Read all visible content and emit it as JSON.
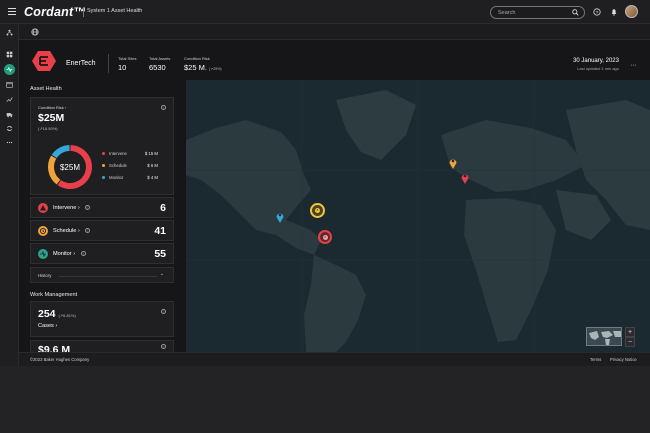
{
  "app": {
    "brand": "Cordant™",
    "section_title": "System 1 Asset Health"
  },
  "search": {
    "placeholder": "Search"
  },
  "header": {
    "site_name": "EnerTech",
    "stats": [
      {
        "label": "Total Sites",
        "value": "10"
      },
      {
        "label": "Total Assets",
        "value": "6530"
      },
      {
        "label": "Condition Risk",
        "value": "$25 M.",
        "delta": "(↗25%)"
      }
    ],
    "date": "30 January, 2023",
    "updated": "Last updated 1 min ago"
  },
  "asset_health": {
    "title": "Asset Health",
    "condition_risk_label": "Condition Risk",
    "total": "$25M",
    "delta": "(↗18.50%)",
    "donut_center": "$25M",
    "legend": [
      {
        "label": "Intervene",
        "amount": "$ 15 M",
        "color": "#e8404a",
        "share": 0.6
      },
      {
        "label": "Schedule",
        "amount": "$ 6 M",
        "color": "#f2a23a",
        "share": 0.24
      },
      {
        "label": "Monitor",
        "amount": "$ 4 M",
        "color": "#35a7d8",
        "share": 0.16
      }
    ],
    "rows": [
      {
        "label": "Intervene",
        "value": "6",
        "color": "#e8404a"
      },
      {
        "label": "Schedule",
        "value": "41",
        "color": "#f2a23a"
      },
      {
        "label": "Monitor",
        "value": "55",
        "color": "#2aa38f"
      }
    ],
    "history_label": "History"
  },
  "work_management": {
    "title": "Work Management",
    "cases_value": "254",
    "cases_delta": "(↗6.81%)",
    "cases_label": "Cases",
    "next_value": "$9.6 M"
  },
  "map": {
    "clusters": [
      {
        "count": "8",
        "color": "#f2c53a"
      },
      {
        "count": "4",
        "color": "#e8404a"
      }
    ],
    "zoom_in": "+",
    "zoom_out": "−"
  },
  "footer": {
    "copyright": "©2023 Baker Hughes Company",
    "terms": "Terms",
    "privacy": "Privacy Notice"
  }
}
